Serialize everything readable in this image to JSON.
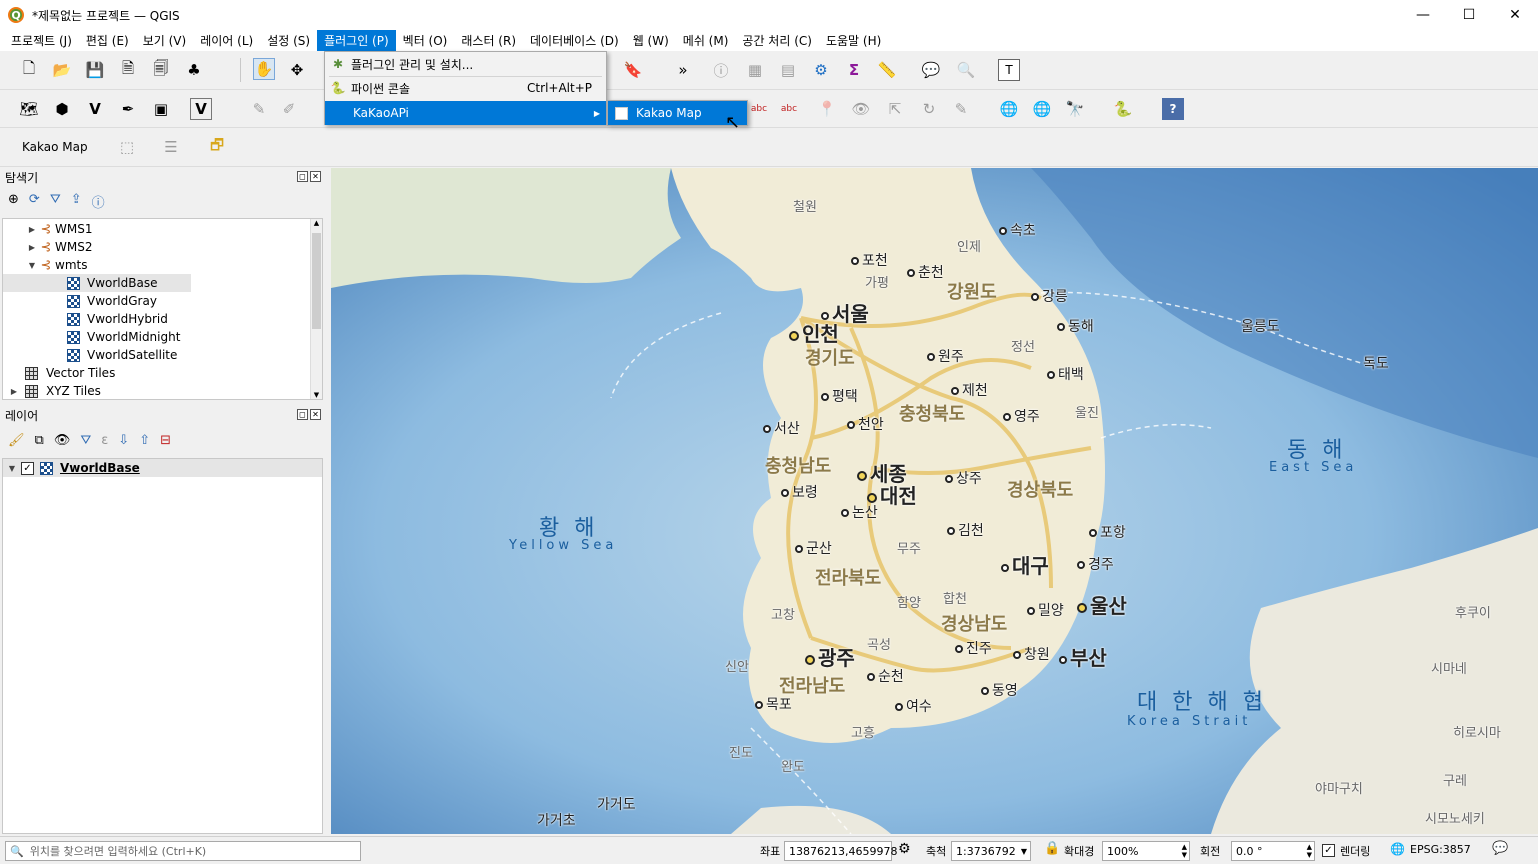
{
  "window": {
    "title": "*제목없는 프로젝트 — QGIS",
    "minimize": "—",
    "maximize": "☐",
    "close": "✕"
  },
  "menu": [
    "프로젝트 (J)",
    "편집 (E)",
    "보기 (V)",
    "레이어 (L)",
    "설정 (S)",
    "플러그인 (P)",
    "벡터 (O)",
    "래스터 (R)",
    "데이터베이스 (D)",
    "웹 (W)",
    "메쉬 (M)",
    "공간 처리 (C)",
    "도움말 (H)"
  ],
  "plugin_menu": {
    "manage": "플러그인 관리 및 설치...",
    "python_console": "파이썬 콘솔",
    "python_shortcut": "Ctrl+Alt+P",
    "kakaoapi": "KaKaoAPi",
    "submenu_item": "Kakao Map"
  },
  "toolbar3": {
    "kakao_label": "Kakao Map"
  },
  "browser": {
    "title": "탐색기",
    "items": [
      {
        "label": "WMS1",
        "kind": "wms",
        "expanded": false
      },
      {
        "label": "WMS2",
        "kind": "wms",
        "expanded": false
      },
      {
        "label": "wmts",
        "kind": "wms",
        "expanded": true
      },
      {
        "label": "VworldBase",
        "kind": "tile",
        "selected": true
      },
      {
        "label": "VworldGray",
        "kind": "tile"
      },
      {
        "label": "VworldHybrid",
        "kind": "tile"
      },
      {
        "label": "VworldMidnight",
        "kind": "tile"
      },
      {
        "label": "VworldSatellite",
        "kind": "tile"
      },
      {
        "label": "Vector Tiles",
        "kind": "grid"
      },
      {
        "label": "XYZ Tiles",
        "kind": "grid"
      }
    ]
  },
  "layers": {
    "title": "레이어",
    "items": [
      {
        "label": "VworldBase",
        "checked": true
      }
    ]
  },
  "map": {
    "cities": [
      "철원",
      "속초",
      "포천",
      "인제",
      "가평",
      "춘천",
      "강릉",
      "서울",
      "인천",
      "동해",
      "울릉도",
      "독도",
      "경기도",
      "원주",
      "강원도",
      "정선",
      "태백",
      "평택",
      "제천",
      "충청북도",
      "영주",
      "울진",
      "서산",
      "천안",
      "충청남도",
      "세종",
      "상주",
      "대전",
      "보령",
      "논산",
      "경상북도",
      "김천",
      "포항",
      "군산",
      "무주",
      "대구",
      "경주",
      "전라북도",
      "함양",
      "합천",
      "울산",
      "고창",
      "밀양",
      "광주",
      "곡성",
      "경상남도",
      "진주",
      "창원",
      "부산",
      "신안",
      "순천",
      "전라남도",
      "동영",
      "목포",
      "여수",
      "고흥",
      "진도",
      "완도",
      "가거초",
      "가거도",
      "후쿠이",
      "시마네",
      "히로시마",
      "구레",
      "야마구치",
      "시모노세키"
    ],
    "seas": {
      "yellow_ko": "황 해",
      "yellow_en": "Yellow Sea",
      "east_ko": "동 해",
      "east_en": "East Sea",
      "strait_ko": "대 한 해 협",
      "strait_en": "Korea Strait"
    }
  },
  "status": {
    "search_placeholder": "위치를 찾으려면 입력하세요 (Ctrl+K)",
    "coord_label": "좌표",
    "coord_value": "13876213,4659978",
    "scale_label": "축척",
    "scale_value": "1:3736792",
    "magnifier_label": "확대경",
    "magnifier_value": "100%",
    "rotation_label": "회전",
    "rotation_value": "0.0 °",
    "render_label": "렌더링",
    "crs": "EPSG:3857"
  }
}
